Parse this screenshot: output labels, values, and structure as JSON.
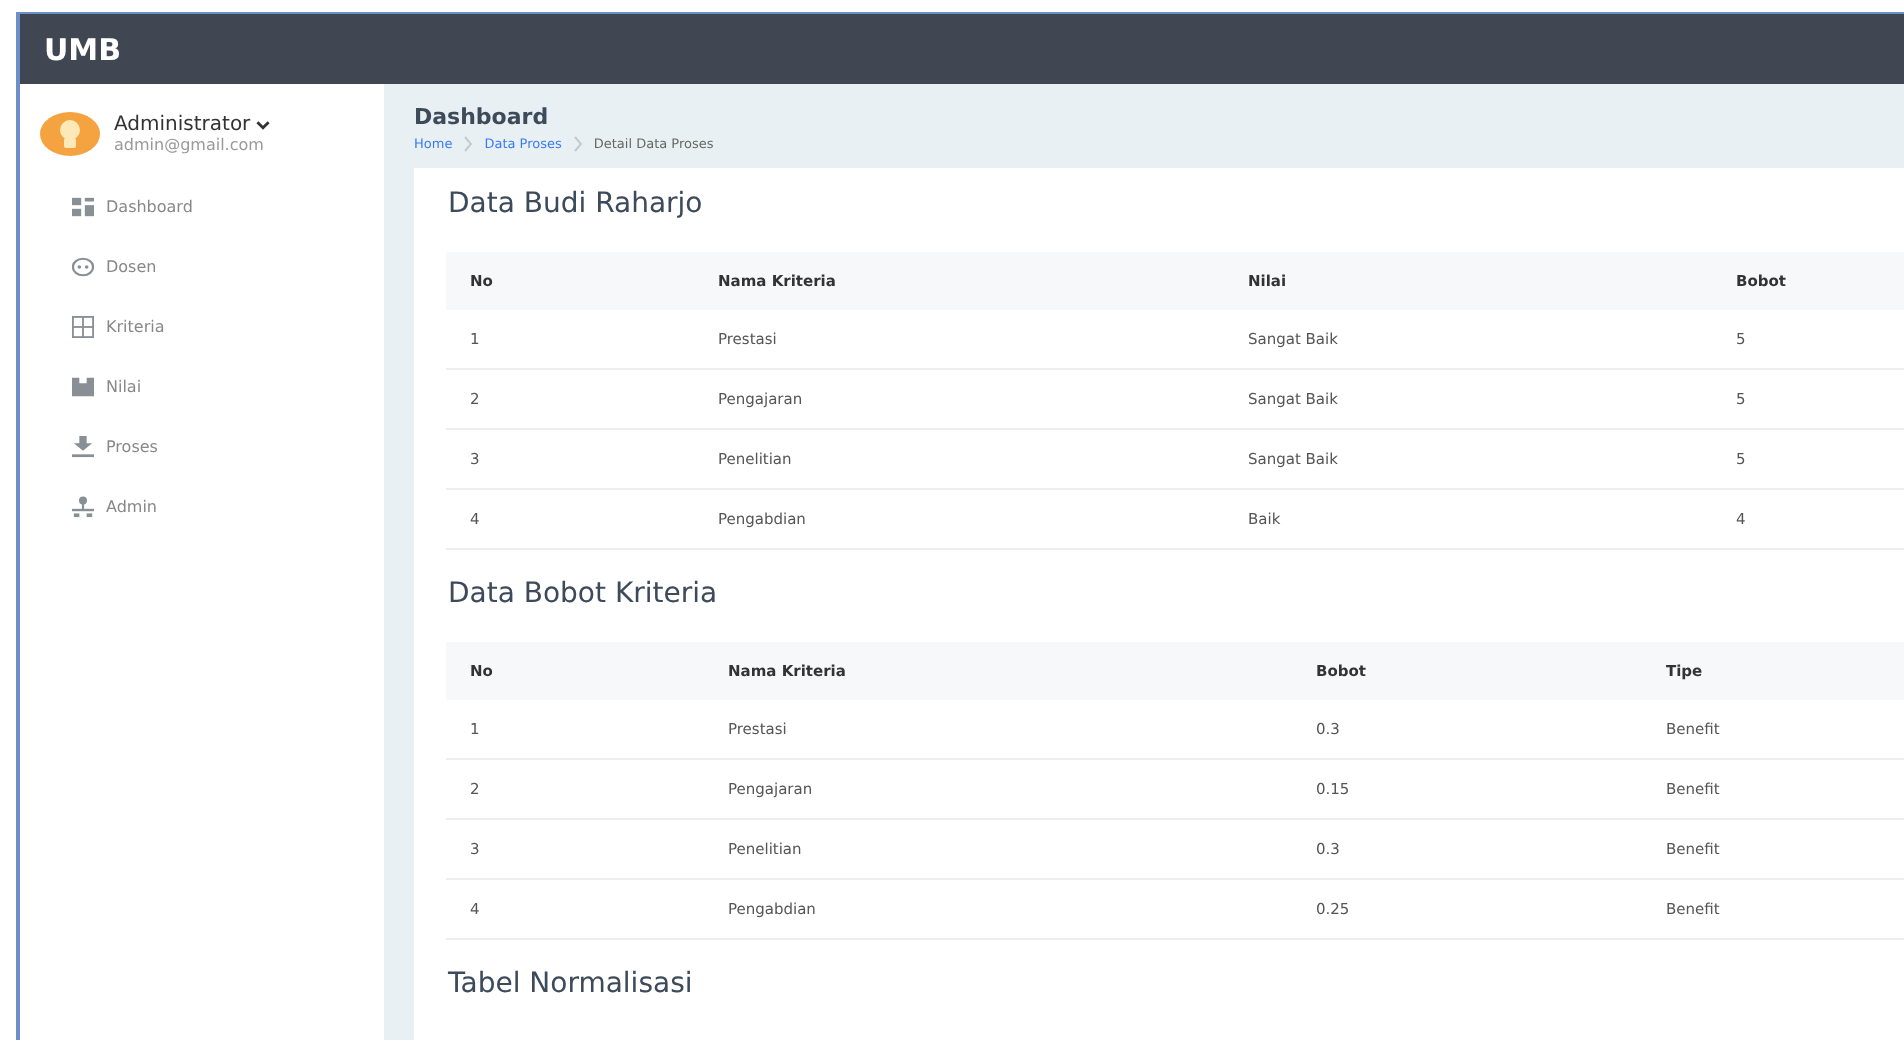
{
  "app": {
    "title": "UMB"
  },
  "user": {
    "name": "Administrator",
    "email": "admin@gmail.com"
  },
  "sidebar": {
    "items": [
      {
        "label": "Dashboard",
        "kind": "dashboard"
      },
      {
        "label": "Dosen",
        "kind": "dosen"
      },
      {
        "label": "Kriteria",
        "kind": "kriteria"
      },
      {
        "label": "Nilai",
        "kind": "nilai"
      },
      {
        "label": "Proses",
        "kind": "proses"
      },
      {
        "label": "Admin",
        "kind": "admin"
      }
    ]
  },
  "page_header": {
    "title": "Dashboard",
    "breadcrumb": [
      {
        "label": "Home",
        "link": true
      },
      {
        "label": "Data Proses",
        "link": true
      },
      {
        "label": "Detail Data Proses",
        "link": false
      }
    ]
  },
  "sections": [
    {
      "title": "Data Budi Raharjo",
      "columns": [
        "No",
        "Nama Kriteria",
        "Nilai",
        "Bobot"
      ],
      "rows": [
        [
          "1",
          "Prestasi",
          "Sangat Baik",
          "5"
        ],
        [
          "2",
          "Pengajaran",
          "Sangat Baik",
          "5"
        ],
        [
          "3",
          "Penelitian",
          "Sangat Baik",
          "5"
        ],
        [
          "4",
          "Pengabdian",
          "Baik",
          "4"
        ]
      ]
    },
    {
      "title": "Data Bobot Kriteria",
      "columns": [
        "No",
        "Nama Kriteria",
        "Bobot",
        "Tipe"
      ],
      "rows": [
        [
          "1",
          "Prestasi",
          "0.3",
          "Benefit"
        ],
        [
          "2",
          "Pengajaran",
          "0.15",
          "Benefit"
        ],
        [
          "3",
          "Penelitian",
          "0.3",
          "Benefit"
        ],
        [
          "4",
          "Pengabdian",
          "0.25",
          "Benefit"
        ]
      ]
    },
    {
      "title": "Tabel Normalisasi"
    }
  ]
}
